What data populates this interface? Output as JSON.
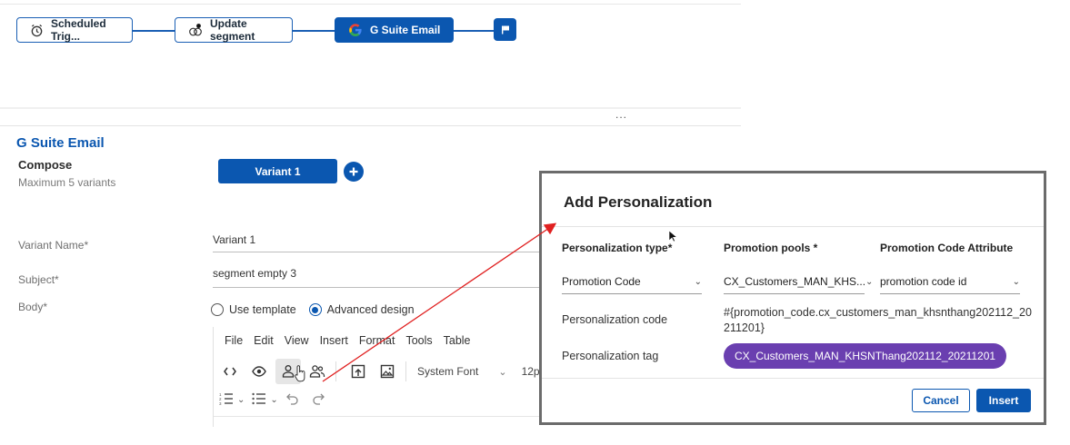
{
  "workflow": {
    "nodes": [
      {
        "label": "Scheduled Trig...",
        "icon": "alarm-clock-icon"
      },
      {
        "label": "Update segment",
        "icon": "segment-circles-icon"
      },
      {
        "label": "G Suite Email",
        "icon": "google-g-icon",
        "active": true
      }
    ],
    "end_icon": "flag-icon",
    "more": "..."
  },
  "panel": {
    "title": "G Suite Email",
    "compose_title": "Compose",
    "compose_subtitle": "Maximum 5 variants",
    "variant_tab": "Variant 1",
    "add_variant_icon": "plus-circle-icon"
  },
  "form": {
    "variant_name_label": "Variant Name*",
    "variant_name_value": "Variant 1",
    "subject_label": "Subject*",
    "subject_value": "segment empty 3",
    "body_label": "Body*",
    "body_options": [
      "Use template",
      "Advanced design"
    ],
    "body_selected": "Advanced design"
  },
  "editor": {
    "menu": [
      "File",
      "Edit",
      "View",
      "Insert",
      "Format",
      "Tools",
      "Table"
    ],
    "font": "System Font",
    "size_fragment": "12p"
  },
  "modal": {
    "title": "Add Personalization",
    "col_personalization_type": "Personalization type*",
    "col_promotion_pools": "Promotion pools *",
    "col_promotion_attr": "Promotion Code Attribute",
    "type_value": "Promotion Code",
    "pool_value": "CX_Customers_MAN_KHS...",
    "attr_value": "promotion code id",
    "code_label": "Personalization code",
    "code_value": "#{promotion_code.cx_customers_man_khsnthang202112_20211201}",
    "tag_label": "Personalization tag",
    "tag_value": "CX_Customers_MAN_KHSNThang202112_20211201",
    "cancel": "Cancel",
    "insert": "Insert"
  },
  "colors": {
    "primary": "#0b57b0",
    "tag": "#6a3fb0",
    "annotation_arrow": "#e02020"
  }
}
